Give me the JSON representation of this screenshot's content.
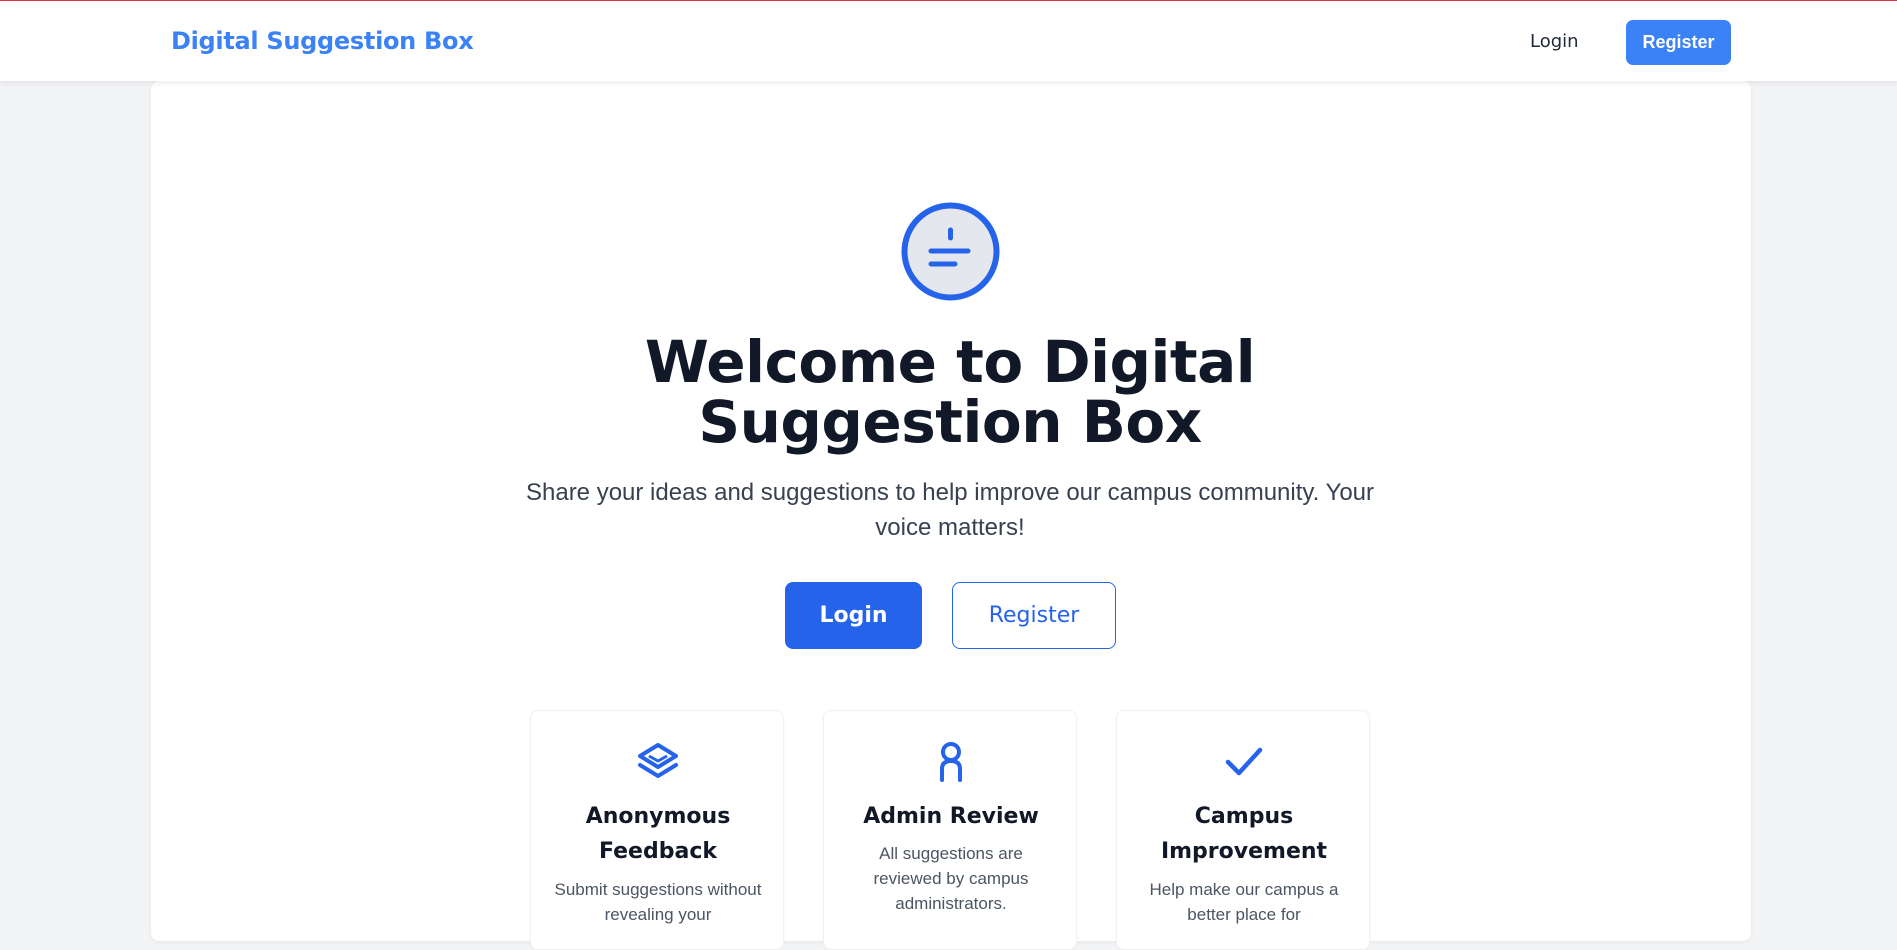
{
  "nav": {
    "brand": "Digital Suggestion Box",
    "login_label": "Login",
    "register_label": "Register"
  },
  "hero": {
    "icon": "divide-circle-icon",
    "title": "Welcome to Digital Suggestion Box",
    "subtitle": "Share your ideas and suggestions to help improve our campus community. Your voice matters!",
    "login_label": "Login",
    "register_label": "Register"
  },
  "features": [
    {
      "icon": "layers-icon",
      "title": "Anonymous Feedback",
      "description": "Submit suggestions without revealing your"
    },
    {
      "icon": "user-icon",
      "title": "Admin Review",
      "description": "All suggestions are reviewed by campus administrators."
    },
    {
      "icon": "check-icon",
      "title": "Campus Improvement",
      "description": "Help make our campus a better place for"
    }
  ],
  "colors": {
    "primary": "#2563eb",
    "brand": "#3b82f6",
    "background": "#f3f4f6",
    "heading": "#111827"
  }
}
